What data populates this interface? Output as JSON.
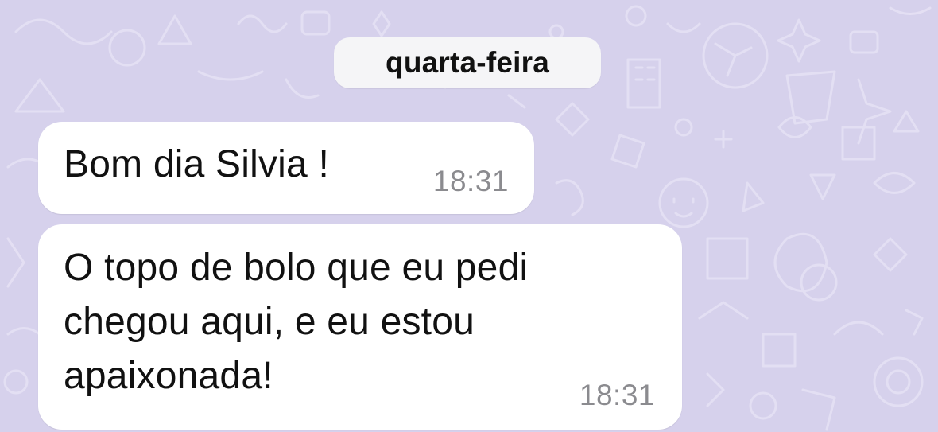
{
  "chat": {
    "date_separator": "quarta-feira",
    "messages": [
      {
        "text": "Bom dia Silvia !",
        "time": "18:31"
      },
      {
        "text": "O topo de bolo que eu pedi chegou aqui, e eu estou apaixonada!",
        "time": "18:31"
      }
    ]
  },
  "colors": {
    "wallpaper": "#d6d1ec",
    "bubble": "#ffffff",
    "date_pill": "#f5f5f7",
    "text": "#111111",
    "timestamp": "#8b8b8f"
  }
}
